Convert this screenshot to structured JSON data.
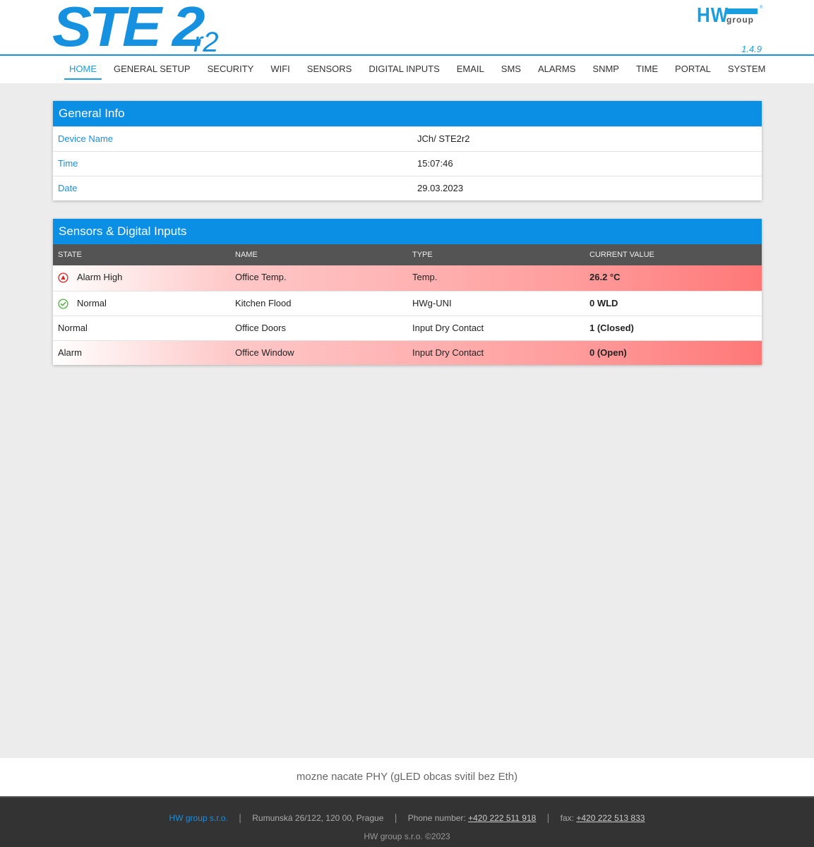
{
  "header": {
    "logo_main": "STE 2",
    "logo_suffix": "r2",
    "brand_hw": "HW",
    "brand_group": "group",
    "brand_reg": "®",
    "version": "1.4.9"
  },
  "nav": {
    "items": [
      {
        "label": "HOME",
        "active": true
      },
      {
        "label": "GENERAL SETUP"
      },
      {
        "label": "SECURITY"
      },
      {
        "label": "WIFI"
      },
      {
        "label": "SENSORS"
      },
      {
        "label": "DIGITAL INPUTS"
      },
      {
        "label": "EMAIL"
      },
      {
        "label": "SMS"
      },
      {
        "label": "ALARMS"
      },
      {
        "label": "SNMP"
      },
      {
        "label": "TIME"
      },
      {
        "label": "PORTAL"
      },
      {
        "label": "SYSTEM"
      }
    ]
  },
  "general_info": {
    "title": "General Info",
    "rows": [
      {
        "label": "Device Name",
        "value": "JCh/ STE2r2"
      },
      {
        "label": "Time",
        "value": "15:07:46"
      },
      {
        "label": "Date",
        "value": "29.03.2023"
      }
    ]
  },
  "sensors": {
    "title": "Sensors & Digital Inputs",
    "columns": [
      "STATE",
      "NAME",
      "TYPE",
      "CURRENT VALUE"
    ],
    "rows": [
      {
        "state": "Alarm High",
        "state_icon": "alarm-high-icon",
        "name": "Office Temp.",
        "type": "Temp.",
        "value": "26.2 °C",
        "alarm": true
      },
      {
        "state": "Normal",
        "state_icon": "check-icon",
        "name": "Kitchen Flood",
        "type": "HWg-UNI",
        "value": "0 WLD",
        "alarm": false
      },
      {
        "state": "Normal",
        "name": "Office Doors",
        "type": "Input Dry Contact",
        "value": "1 (Closed)",
        "alarm": false
      },
      {
        "state": "Alarm",
        "name": "Office Window",
        "type": "Input Dry Contact",
        "value": "0 (Open)",
        "alarm": true
      }
    ]
  },
  "notice": "mozne nacate PHY (gLED obcas svitil bez Eth)",
  "footer": {
    "company": "HW group s.r.o.",
    "address": "Rumunská 26/122, 120 00, Prague",
    "phone_label": "Phone number:",
    "phone": "+420 222 511 918",
    "fax_label": "fax:",
    "fax": "+420 222 513 833",
    "separator": "|",
    "copyright": "HW group s.r.o. ©2023"
  },
  "colors": {
    "accent": "#0b8fe4",
    "table_header": "#545454",
    "alarm": "#ff7777",
    "ok": "#4caf50",
    "footer_bg": "#333333"
  }
}
